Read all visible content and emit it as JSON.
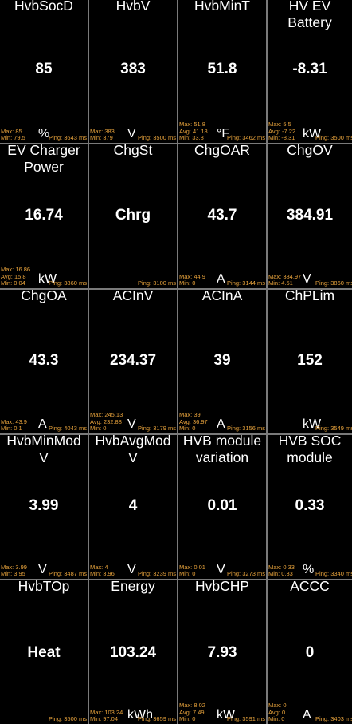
{
  "tiles": [
    {
      "id": "hvbsocd",
      "title": "HvbSocD",
      "value": "85",
      "unit": "%",
      "stats": "Max: 85\nMin: 79.5",
      "ping": "Ping: 3643 ms"
    },
    {
      "id": "hvbv",
      "title": "HvbV",
      "value": "383",
      "unit": "V",
      "stats": "Max: 383\nMin: 379",
      "ping": "Ping: 3500 ms"
    },
    {
      "id": "hvbmint",
      "title": "HvbMinT",
      "value": "51.8",
      "unit": "°F",
      "stats": "Max: 51.8\nAvg: 41.18\nMin: 33.8",
      "ping": "Ping: 3462 ms"
    },
    {
      "id": "hv-ev-battery",
      "title": "HV EV\nBattery",
      "value": "-8.31",
      "unit": "kW",
      "stats": "Max: 5.5\nAvg: -7.22\nMin: -8.31",
      "ping": "Ping: 3500 ms"
    },
    {
      "id": "ev-charger-power",
      "title": "EV Charger\nPower",
      "value": "16.74",
      "unit": "kW",
      "stats": "Max: 16.86\nAvg: 15.8\nMin: 0.04",
      "ping": "Ping: 3860 ms"
    },
    {
      "id": "chgst",
      "title": "ChgSt",
      "value": "Chrg",
      "unit": "",
      "stats": "",
      "ping": "Ping: 3100 ms"
    },
    {
      "id": "chgoar",
      "title": "ChgOAR",
      "value": "43.7",
      "unit": "A",
      "stats": "Max: 44.9\nMin: 0",
      "ping": "Ping: 3144 ms"
    },
    {
      "id": "chgov",
      "title": "ChgOV",
      "value": "384.91",
      "unit": "V",
      "stats": "Max: 384.97\nMin: 4.51",
      "ping": "Ping: 3860 ms"
    },
    {
      "id": "chgoa",
      "title": "ChgOA",
      "value": "43.3",
      "unit": "A",
      "stats": "Max: 43.9\nMin: 0.1",
      "ping": "Ping: 4043 ms"
    },
    {
      "id": "acinv",
      "title": "ACInV",
      "value": "234.37",
      "unit": "V",
      "stats": "Max: 245.13\nAvg: 232.88\nMin: 0",
      "ping": "Ping: 3179 ms"
    },
    {
      "id": "acina",
      "title": "ACInA",
      "value": "39",
      "unit": "A",
      "stats": "Max: 39\nAvg: 36.97\nMin: 0",
      "ping": "Ping: 3156 ms"
    },
    {
      "id": "chplim",
      "title": "ChPLim",
      "value": "152",
      "unit": "kW",
      "stats": "",
      "ping": "Ping: 3549 ms"
    },
    {
      "id": "hvbminmodv",
      "title": "HvbMinMod\nV",
      "value": "3.99",
      "unit": "V",
      "stats": "Max: 3.99\nMin: 3.95",
      "ping": "Ping: 3487 ms"
    },
    {
      "id": "hvbavgmodv",
      "title": "HvbAvgMod\nV",
      "value": "4",
      "unit": "V",
      "stats": "Max: 4\nMin: 3.96",
      "ping": "Ping: 3239 ms"
    },
    {
      "id": "hvb-module-variation",
      "title": "HVB module\nvariation",
      "value": "0.01",
      "unit": "V",
      "stats": "Max: 0.01\nMin: 0",
      "ping": "Ping: 3273 ms"
    },
    {
      "id": "hvb-soc-module",
      "title": "HVB SOC\nmodule",
      "value": "0.33",
      "unit": "%",
      "stats": "Max: 0.33\nMin: 0.33",
      "ping": "Ping: 3340 ms"
    },
    {
      "id": "hvbtop",
      "title": "HvbTOp",
      "value": "Heat",
      "unit": "",
      "stats": "",
      "ping": "Ping: 3500 ms"
    },
    {
      "id": "energy",
      "title": "Energy",
      "value": "103.24",
      "unit": "kWh",
      "stats": "Max: 103.24\nMin: 97.04",
      "ping": "Ping: 3659 ms"
    },
    {
      "id": "hvbchp",
      "title": "HvbCHP",
      "value": "7.93",
      "unit": "kW",
      "stats": "Max: 8.02\nAvg: 7.49\nMin: 0",
      "ping": "Ping: 3591 ms"
    },
    {
      "id": "accc",
      "title": "ACCC",
      "value": "0",
      "unit": "A",
      "stats": "Max: 0\nAvg: 0\nMin: 0",
      "ping": "Ping: 3403 ms"
    }
  ]
}
